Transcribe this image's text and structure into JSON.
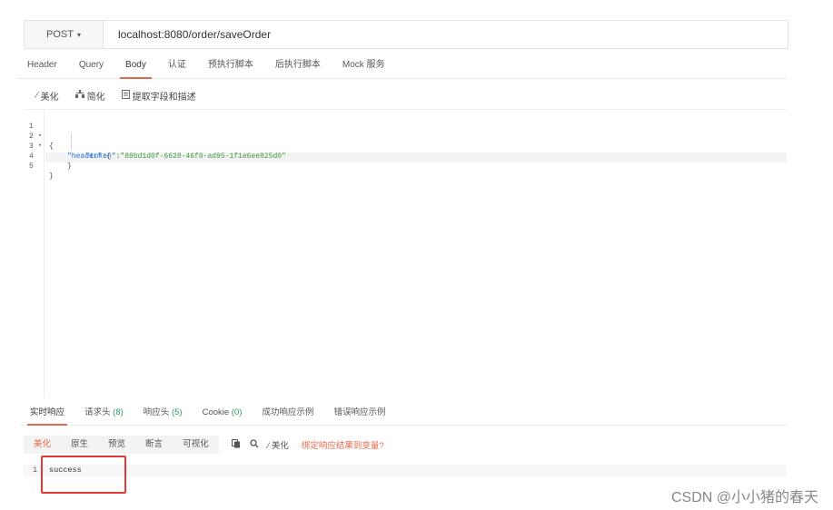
{
  "request": {
    "method": "POST",
    "method_caret": "▾",
    "url": "localhost:8080/order/saveOrder"
  },
  "request_tabs": [
    {
      "label": "Header"
    },
    {
      "label": "Query"
    },
    {
      "label": "Body",
      "active": true
    },
    {
      "label": "认证"
    },
    {
      "label": "预执行脚本"
    },
    {
      "label": "后执行脚本"
    },
    {
      "label": "Mock 服务"
    }
  ],
  "editor_toolbar": {
    "beautify": "美化",
    "simplify": "简化",
    "extract": "提取字段和描述"
  },
  "editor": {
    "lines": [
      {
        "number": "1",
        "fold": "▾",
        "text": "{"
      },
      {
        "number": "2",
        "fold": "▾",
        "key": "\"header\"",
        "rest": ":{"
      },
      {
        "number": "3",
        "fold": "",
        "key": "\"token\"",
        "colon": ":",
        "value": "\"89bd1d0f-6628-46f0-ad95-1f1e6ee825d0\""
      },
      {
        "number": "4",
        "fold": "",
        "text": "}"
      },
      {
        "number": "5",
        "fold": "",
        "text": "}"
      }
    ]
  },
  "response_tabs": {
    "realtime": "实时响应",
    "request_headers": "请求头",
    "request_headers_count": "(8)",
    "response_headers": "响应头",
    "response_headers_count": "(5)",
    "cookie": "Cookie",
    "cookie_count": "(0)",
    "success_example": "成功响应示例",
    "error_example": "错误响应示例"
  },
  "response_toolbar": {
    "views": [
      "美化",
      "原生",
      "预览",
      "断言",
      "可视化"
    ],
    "beautify": "美化",
    "bind_link": "绑定响应结果到变量?"
  },
  "response_body": {
    "line_number": "1",
    "value": "success"
  },
  "watermark": "CSDN @小小猪的春天",
  "colors": {
    "accent": "#e56a4c",
    "key": "#2a6fd6",
    "string": "#3c9a42",
    "highlight_box": "#e53935"
  }
}
